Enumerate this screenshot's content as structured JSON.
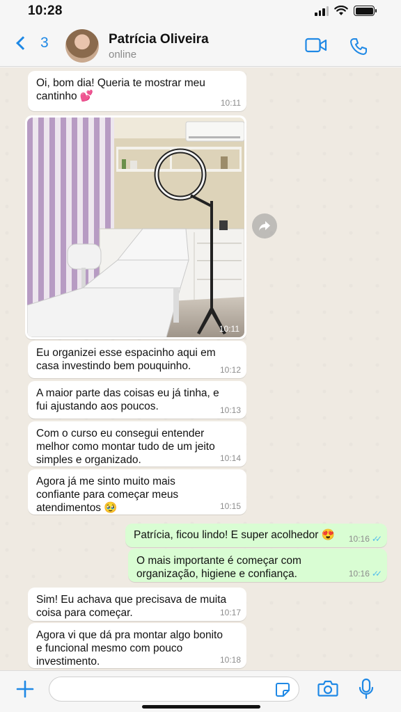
{
  "status_bar": {
    "time": "10:28"
  },
  "header": {
    "back_count": "3",
    "contact_name": "Patrícia Oliveira",
    "contact_status": "online"
  },
  "colors": {
    "accent": "#1e88e5",
    "outgoing_bubble": "#d9fdd3",
    "incoming_bubble": "#ffffff",
    "read_ticks": "#53bdeb",
    "chat_bg": "#efeae2"
  },
  "messages": [
    {
      "direction": "in",
      "text": "Oi, bom dia! Queria te mostrar meu\ncantinho 💕",
      "time": "10:11"
    },
    {
      "direction": "in",
      "type": "image",
      "time": "10:11"
    },
    {
      "direction": "in",
      "text": "Eu organizei esse espacinho aqui em\ncasa investindo bem pouquinho.",
      "time": "10:12"
    },
    {
      "direction": "in",
      "text": "A maior parte das coisas eu já tinha, e\nfui ajustando aos poucos.",
      "time": "10:13"
    },
    {
      "direction": "in",
      "text": "Com o curso eu consegui entender\nmelhor como montar tudo de um jeito\nsimples e organizado.",
      "time": "10:14"
    },
    {
      "direction": "in",
      "text": "Agora já me sinto muito mais\nconfiante para começar meus\natendimentos 🥹",
      "time": "10:15"
    },
    {
      "direction": "out",
      "text": "Patrícia, ficou lindo! E super acolhedor 😍",
      "time": "10:16",
      "read": true
    },
    {
      "direction": "out",
      "text": "O mais importante é começar com\norganização, higiene e confiança.",
      "time": "10:16",
      "read": true
    },
    {
      "direction": "in",
      "text": "Sim! Eu achava que precisava de muita\ncoisa para começar.",
      "time": "10:17"
    },
    {
      "direction": "in",
      "text": "Agora vi que dá pra montar algo bonito\ne funcional mesmo com pouco\ninvestimento.",
      "time": "10:18"
    }
  ],
  "input": {
    "placeholder": ""
  }
}
